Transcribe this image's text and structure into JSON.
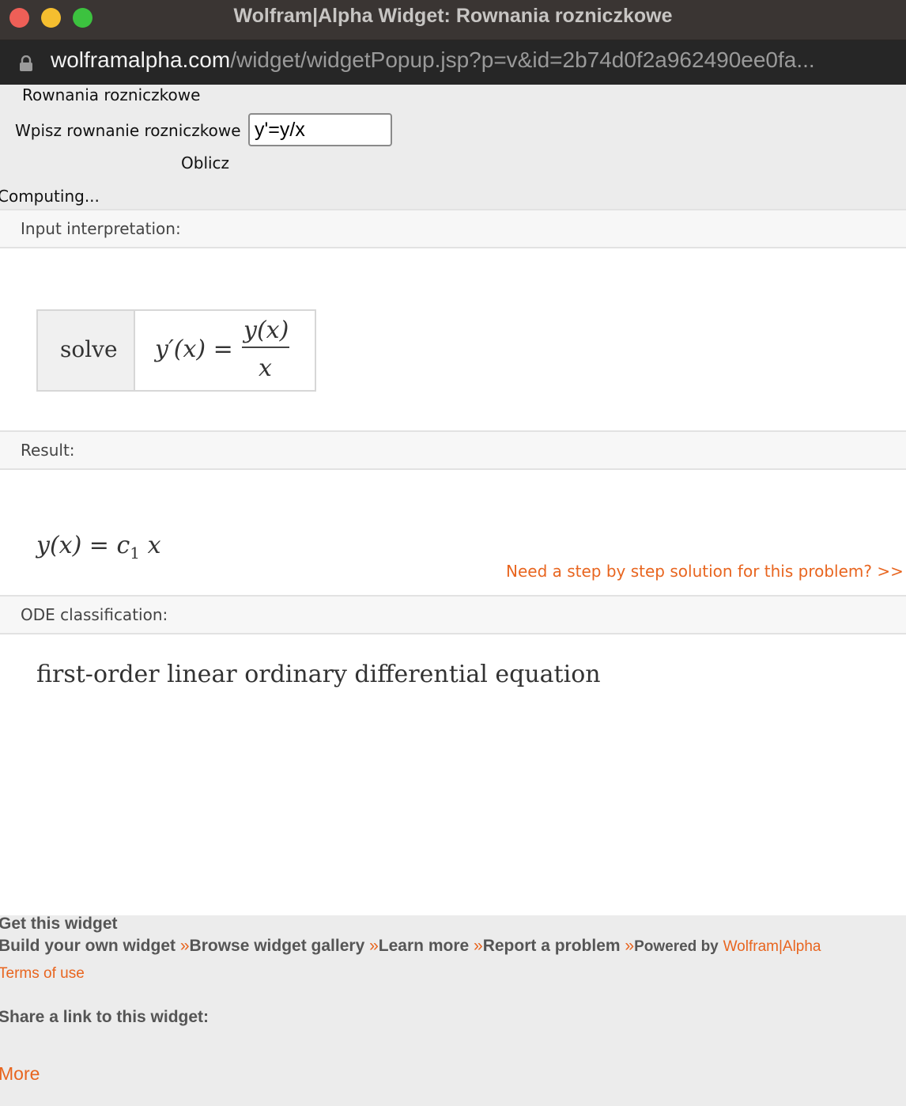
{
  "window": {
    "title": "Wolfram|Alpha Widget: Rownania rozniczkowe",
    "url_host": "wolframalpha.com",
    "url_path": "/widget/widgetPopup.jsp?p=v&id=2b74d0f2a962490ee0fa..."
  },
  "form": {
    "widget_title": "Rownania rozniczkowe",
    "prompt_label": "Wpisz rownanie rozniczkowe",
    "input_value": "y'=y/x",
    "submit_label": "Oblicz",
    "status": "Computing..."
  },
  "pods": {
    "input": {
      "header": "Input interpretation:",
      "solve_label": "solve",
      "equation_left": "y′(x) =",
      "numerator": "y(x)",
      "denominator": "x"
    },
    "result": {
      "header": "Result:",
      "lhs": "y(x) = c",
      "subscript": "1",
      "rhs": " x",
      "step_link": "Need a step by step solution for this problem?  >>"
    },
    "classification": {
      "header": "ODE classification:",
      "text": "first-order linear ordinary differential equation"
    }
  },
  "footer": {
    "get_widget": "Get this widget",
    "build": "Build your own widget",
    "browse": "Browse widget gallery",
    "learn": "Learn more",
    "report": "Report a problem",
    "raquo": "»",
    "powered_prefix": "Powered by",
    "powered_link": "Wolfram|Alpha",
    "terms": "Terms of use",
    "share": "Share a link to this widget:",
    "more": "More"
  },
  "colors": {
    "accent": "#e8651f",
    "titlebar": "#3a3533",
    "urlbar": "#262626"
  }
}
